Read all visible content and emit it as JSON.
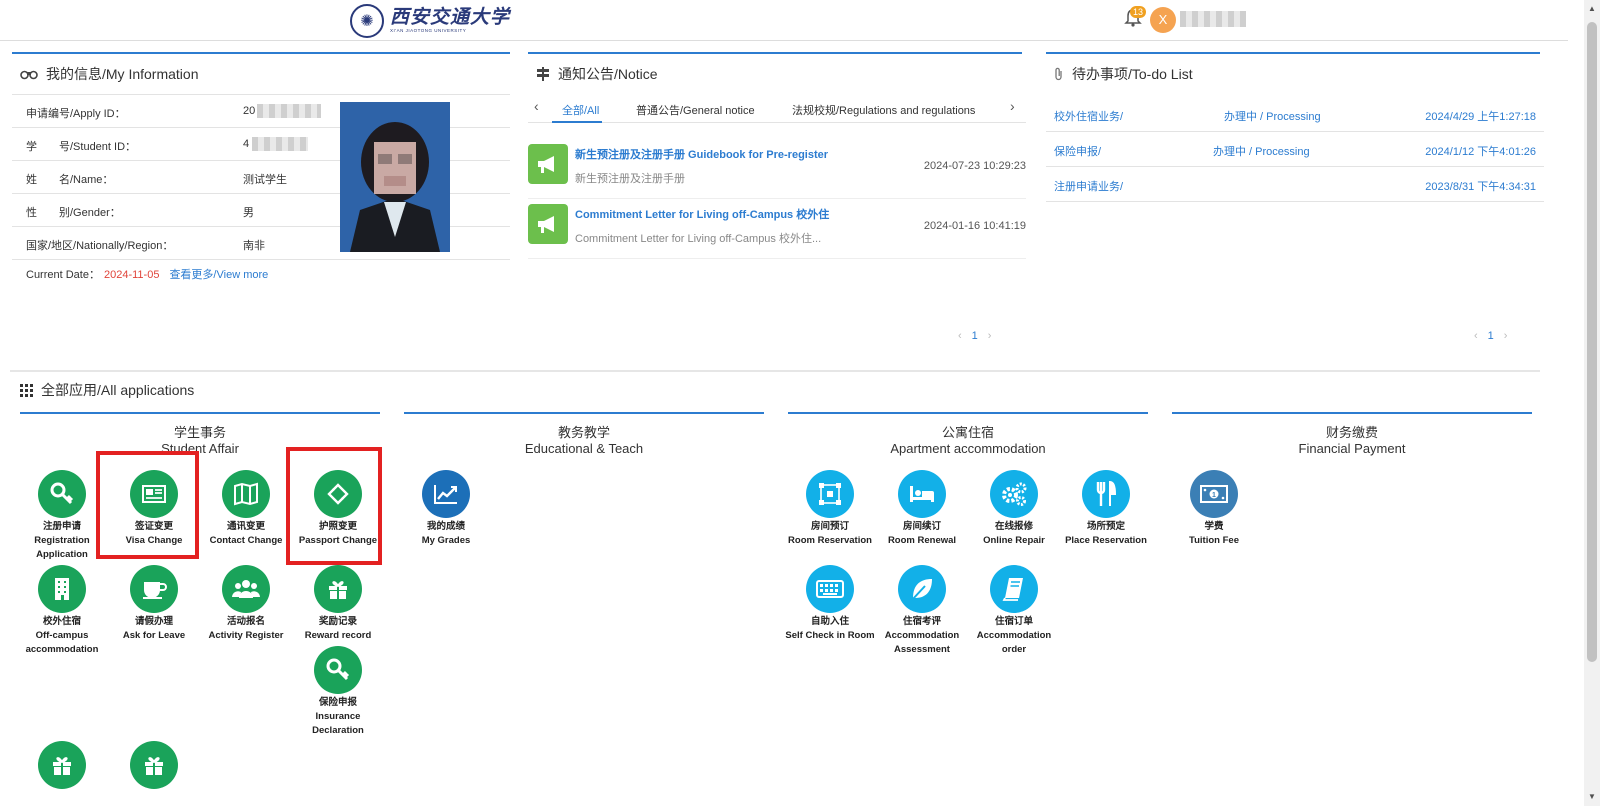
{
  "header": {
    "logo_cn": "西安交通大学",
    "logo_en": "XI'AN JIAOTONG UNIVERSITY",
    "notification_count": "13",
    "avatar_letter": "X"
  },
  "my_info": {
    "title": "我的信息/My Information",
    "rows": [
      {
        "label": "申请编号/Apply ID：",
        "value": "20"
      },
      {
        "label": "学　　号/Student ID：",
        "value": "4"
      },
      {
        "label": "姓　　名/Name：",
        "value": "测试学生"
      },
      {
        "label": "性　　别/Gender：",
        "value": "男"
      },
      {
        "label": "国家/地区/Nationally/Region：",
        "value": "南非"
      }
    ],
    "current_date_label": "Current Date：",
    "current_date": "2024-11-05",
    "view_more": "查看更多/View more"
  },
  "notice": {
    "title": "通知公告/Notice",
    "tabs": [
      "全部/All",
      "普通公告/General notice",
      "法规校规/Regulations and regulations"
    ],
    "items": [
      {
        "title": "新生预注册及注册手册 Guidebook for Pre-register",
        "subtitle": "新生预注册及注册手册",
        "time": "2024-07-23 10:29:23"
      },
      {
        "title": "Commitment Letter for Living off-Campus 校外住",
        "subtitle": "Commitment Letter for Living off-Campus 校外住...",
        "time": "2024-01-16 10:41:19"
      }
    ],
    "page": "1"
  },
  "todo": {
    "title": "待办事项/To-do List",
    "items": [
      {
        "name": "校外住宿业务/",
        "status": "办理中 / Processing",
        "time": "2024/4/29 上午1:27:18"
      },
      {
        "name": "保险申报/",
        "status": "办理中 / Processing",
        "time": "2024/1/12 下午4:01:26"
      },
      {
        "name": "注册申请业务/",
        "status": "",
        "time": "2023/8/31 下午4:34:31"
      }
    ],
    "page": "1"
  },
  "apps": {
    "title": "全部应用/All applications",
    "categories": [
      {
        "cn": "学生事务",
        "en": "Student Affair"
      },
      {
        "cn": "教务教学",
        "en": "Educational & Teach"
      },
      {
        "cn": "公寓住宿",
        "en": "Apartment accommodation"
      },
      {
        "cn": "财务缴费",
        "en": "Financial Payment"
      }
    ],
    "student_affair": [
      {
        "cn": "注册申请",
        "en": "Registration Application",
        "icon": "key-icon"
      },
      {
        "cn": "签证变更",
        "en": "Visa Change",
        "icon": "id-card-icon"
      },
      {
        "cn": "通讯变更",
        "en": "Contact Change",
        "icon": "map-icon"
      },
      {
        "cn": "护照变更",
        "en": "Passport Change",
        "icon": "swap-icon"
      },
      {
        "cn": "校外住宿",
        "en": "Off-campus accommodation",
        "icon": "building-icon"
      },
      {
        "cn": "请假办理",
        "en": "Ask for Leave",
        "icon": "coffee-icon"
      },
      {
        "cn": "活动报名",
        "en": "Activity Register",
        "icon": "group-icon"
      },
      {
        "cn": "奖励记录",
        "en": "Reward record",
        "icon": "gift-icon"
      },
      {
        "cn": "保险申报",
        "en": "Insurance Declaration",
        "icon": "key-icon"
      }
    ],
    "educational": [
      {
        "cn": "我的成绩",
        "en": "My Grades",
        "icon": "chart-up-icon"
      }
    ],
    "apartment": [
      {
        "cn": "房间预订",
        "en": "Room Reservation",
        "icon": "nodes-icon"
      },
      {
        "cn": "房间续订",
        "en": "Room Renewal",
        "icon": "bed-icon"
      },
      {
        "cn": "在线报修",
        "en": "Online Repair",
        "icon": "gears-icon"
      },
      {
        "cn": "场所预定",
        "en": "Place Reservation",
        "icon": "cutlery-icon"
      },
      {
        "cn": "自助入住",
        "en": "Self Check in Room",
        "icon": "keyboard-icon"
      },
      {
        "cn": "住宿考评",
        "en": "Accommodation Assessment",
        "icon": "leaf-icon"
      },
      {
        "cn": "住宿订单",
        "en": "Accommodation order",
        "icon": "book-icon"
      }
    ],
    "financial": [
      {
        "cn": "学费",
        "en": "Tuition Fee",
        "icon": "money-icon"
      }
    ]
  }
}
